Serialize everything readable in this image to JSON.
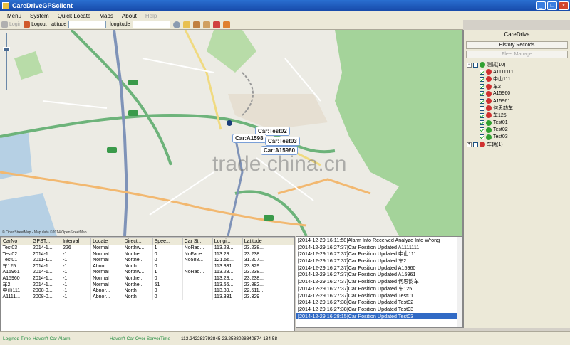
{
  "window": {
    "title": "CareDriveGPSclient",
    "minimize": "_",
    "maximize": "□",
    "close": "×"
  },
  "menu": [
    "Menu",
    "System",
    "Quick Locate",
    "Maps",
    "About",
    "Help"
  ],
  "toolbar": {
    "login": "Login",
    "logout": "Logout",
    "latitude_label": "latitude",
    "longitude_label": "longitude",
    "latitude_value": "",
    "longitude_value": ""
  },
  "map": {
    "attribution": "© OpenStreetMap - Map data ©2014 OpenStreetMap",
    "watermark": "trade.china.cn",
    "car_labels": [
      "Car:Test02",
      "Car:A1598",
      "Car:Test03",
      "Car:A15980"
    ],
    "road_labels": [
      "G42",
      "S41",
      "G15",
      "S42",
      "S15"
    ]
  },
  "right_panel": {
    "title": "CareDrive",
    "history_button": "History Records",
    "fleet_button": "Fleet Manage",
    "groups": [
      {
        "name": "测试(10)",
        "children": [
          "A1111111",
          "中山111",
          "车2",
          "A15960",
          "A15961",
          "何思韵车",
          "车125",
          "Test01",
          "Test02",
          "Test03"
        ]
      },
      {
        "name": "车辆(1)",
        "children": []
      }
    ]
  },
  "grid": {
    "columns": [
      "CarNo",
      "GPST...",
      "Interval",
      "Locate",
      "Direct...",
      "Spee...",
      "Car St...",
      "Longi...",
      "Latitude"
    ],
    "rows": [
      [
        "Test03",
        "2014-1...",
        "226",
        "Normal",
        "Northw...",
        "1",
        "NoRad...",
        "113.28...",
        "23.238..."
      ],
      [
        "Test02",
        "2014-1...",
        "-1",
        "Normal",
        "Northe...",
        "0",
        "NoFace",
        "113.28...",
        "23.238..."
      ],
      [
        "Test01",
        "2011-1...",
        "-1",
        "Normal",
        "Northe...",
        "0",
        "No588...",
        "121.56...",
        "31.207..."
      ],
      [
        "车125",
        "2014-1...",
        "-1",
        "Abnor...",
        "North",
        "0",
        "",
        "113.331",
        "23.329"
      ],
      [
        "A15961",
        "2014-1...",
        "-1",
        "Normal",
        "Northw...",
        "1",
        "NoRad...",
        "113.28...",
        "23.238..."
      ],
      [
        "A15960",
        "2014-1...",
        "-1",
        "Normal",
        "Northe...",
        "0",
        "",
        "113.28...",
        "23.238..."
      ],
      [
        "车2",
        "2014-1...",
        "-1",
        "Normal",
        "Northe...",
        "51",
        "",
        "113.66...",
        "23.882..."
      ],
      [
        "中山111",
        "2008-0...",
        "-1",
        "Abnor...",
        "North",
        "0",
        "",
        "113.39...",
        "22.511..."
      ],
      [
        "A1111...",
        "2008-0...",
        "-1",
        "Abnor...",
        "North",
        "0",
        "",
        "113.331",
        "23.329"
      ]
    ]
  },
  "log": [
    "[2014-12-29 16:11:58]Alarm Info Received  Analyze Info Wrong",
    "[2014-12-29 16:27:37]Car Position Updated  A1111111",
    "[2014-12-29 16:27:37]Car Position Updated  中山111",
    "[2014-12-29 16:27:37]Car Position Updated  车2",
    "[2014-12-29 16:27:37]Car Position Updated  A15960",
    "[2014-12-29 16:27:37]Car Position Updated  A15961",
    "[2014-12-29 16:27:37]Car Position Updated  何思韵车",
    "[2014-12-29 16:27:37]Car Position Updated  车125",
    "[2014-12-29 16:27:37]Car Position Updated  Test01",
    "[2014-12-29 16:27:38]Car Position Updated  Test02",
    "[2014-12-29 16:27:38]Car Position Updated  Test03",
    "[2014-12-29 16:28:15]Car Position Updated  Test03"
  ],
  "status": {
    "login_time": "Logined Time",
    "car_alarm": "Haven't Car Alarm",
    "car_over_server": "Haven't Car Over ServerTime",
    "coords": "113.242283793845  23.2588028840874  134  58"
  },
  "colors": {
    "titlebar": "#1f5bc4",
    "selected": "#316ac5",
    "park_green": "#a4d39a",
    "road_green": "#6db37a"
  }
}
